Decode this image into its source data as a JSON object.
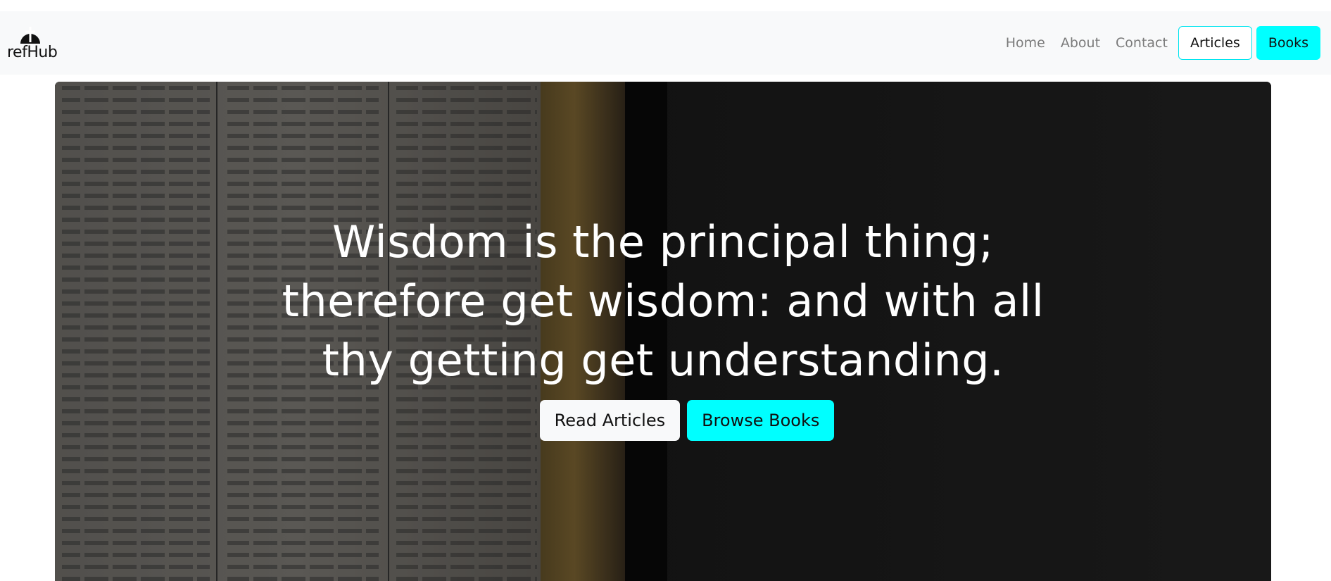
{
  "brand": {
    "name": "refHub",
    "icon": "cross-circle-icon"
  },
  "nav": {
    "links": [
      "Home",
      "About",
      "Contact"
    ],
    "articles_button": "Articles",
    "books_button": "Books"
  },
  "hero": {
    "quote": "Wisdom is the principal thing; therefore get wisdom: and with all thy getting get understanding.",
    "read_articles_button": "Read Articles",
    "browse_books_button": "Browse Books",
    "background": "open-bible-photo"
  },
  "colors": {
    "accent": "#00ffff",
    "navbar_bg": "#f8f9fa",
    "nav_link": "#7b7b7b",
    "hero_text": "#ffffff"
  }
}
